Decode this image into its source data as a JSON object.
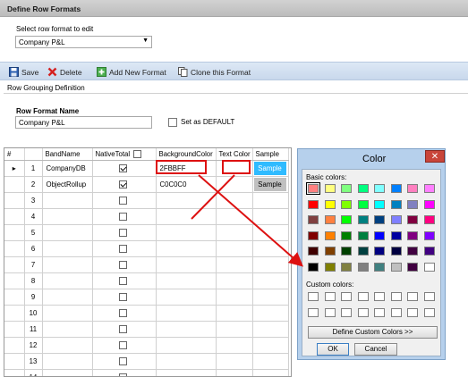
{
  "window": {
    "title": "Define Row Formats"
  },
  "select_format": {
    "label": "Select row format to edit",
    "value": "Company P&L"
  },
  "toolbar": {
    "save": "Save",
    "delete": "Delete",
    "add": "Add New Format",
    "clone": "Clone this Format"
  },
  "grouping": {
    "label": "Row Grouping Definition",
    "name_label": "Row Format Name",
    "name_value": "Company P&L",
    "default_label": "Set as DEFAULT"
  },
  "grid": {
    "headers": [
      "#",
      "BandName",
      "NativeTotal",
      "BackgroundColor",
      "Text Color",
      "Sample"
    ],
    "rows": [
      {
        "idx": "1",
        "band": "CompanyDB",
        "native": true,
        "bg": "2FBBFF",
        "text": "",
        "sample": "Sample"
      },
      {
        "idx": "2",
        "band": "ObjectRollup",
        "native": true,
        "bg": "C0C0C0",
        "text": "",
        "sample": "Sample"
      },
      {
        "idx": "3"
      },
      {
        "idx": "4"
      },
      {
        "idx": "5"
      },
      {
        "idx": "6"
      },
      {
        "idx": "7"
      },
      {
        "idx": "8"
      },
      {
        "idx": "9"
      },
      {
        "idx": "10"
      },
      {
        "idx": "11"
      },
      {
        "idx": "12"
      },
      {
        "idx": "13"
      },
      {
        "idx": "14"
      }
    ]
  },
  "color_dialog": {
    "title": "Color",
    "close": "✕",
    "basic_label": "Basic colors:",
    "custom_label": "Custom colors:",
    "define_button": "Define Custom Colors >>",
    "ok_button": "OK",
    "cancel_button": "Cancel",
    "basic_colors": [
      "#ff8080",
      "#ffff80",
      "#80ff80",
      "#00ff80",
      "#80ffff",
      "#0080ff",
      "#ff80c0",
      "#ff80ff",
      "#ff0000",
      "#ffff00",
      "#80ff00",
      "#00ff40",
      "#00ffff",
      "#0080c0",
      "#8080c0",
      "#ff00ff",
      "#804040",
      "#ff8040",
      "#00ff00",
      "#008080",
      "#004080",
      "#8080ff",
      "#800040",
      "#ff0080",
      "#800000",
      "#ff8000",
      "#008000",
      "#008040",
      "#0000ff",
      "#0000a0",
      "#800080",
      "#8000ff",
      "#400000",
      "#804000",
      "#004000",
      "#004040",
      "#000080",
      "#000040",
      "#400040",
      "#400080",
      "#000000",
      "#808000",
      "#808040",
      "#808080",
      "#408080",
      "#c0c0c0",
      "#400040",
      "#ffffff"
    ]
  },
  "colors": {
    "accent_blue": "#2FBBFF",
    "gray_sample": "#C0C0C0",
    "annotation_red": "#dd1111"
  }
}
